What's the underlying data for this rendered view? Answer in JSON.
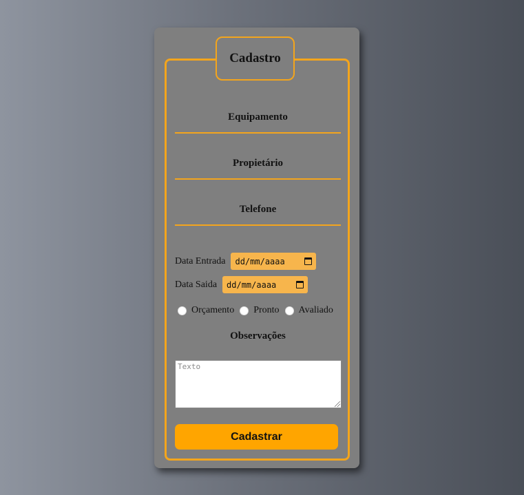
{
  "form": {
    "legend": "Cadastro",
    "fields": [
      {
        "label": "Equipamento"
      },
      {
        "label": "Propietário"
      },
      {
        "label": "Telefone"
      }
    ],
    "date_entry": {
      "label": "Data Entrada",
      "placeholder": "dd/mm/aaaa"
    },
    "date_exit": {
      "label": "Data Saida",
      "placeholder": "dd/mm/aaaa"
    },
    "status_options": [
      {
        "label": "Orçamento"
      },
      {
        "label": "Pronto"
      },
      {
        "label": "Avaliado"
      }
    ],
    "notes": {
      "title": "Observações",
      "placeholder": "Texto"
    },
    "submit_label": "Cadastrar"
  },
  "colors": {
    "accent": "#f4a51c",
    "button": "#ffa500",
    "date_input_bg": "#f7b54c",
    "card_bg": "#7f7f7f"
  },
  "icons": {
    "date": "calendar-icon"
  }
}
